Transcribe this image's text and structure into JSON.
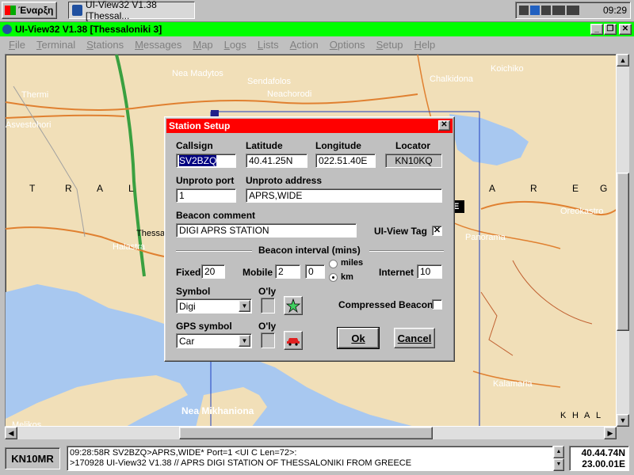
{
  "taskbar": {
    "start_label": "Έναρξη",
    "task_label": "UI-View32 V1.38 [Thessal...",
    "clock": "09:29"
  },
  "window": {
    "title": "UI-View32 V1.38 [Thessaloniki 3]"
  },
  "menu": [
    "File",
    "Terminal",
    "Stations",
    "Messages",
    "Map",
    "Logs",
    "Lists",
    "Action",
    "Options",
    "Setup",
    "Help"
  ],
  "map": {
    "labels": [
      "Nea Madytos",
      "Sendafolos",
      "Neachorodi",
      "Chalkidona",
      "Koichiko",
      "Thermi",
      "Asvestohori",
      "T",
      "R",
      "A",
      "L",
      "Thessaloniki",
      "Halastra",
      "A",
      "R",
      "E",
      "G",
      "Oreokastro",
      "Panorama",
      "Kalamaria",
      "Nea Mikhaniona",
      "Melikos",
      "K",
      "H",
      "A",
      "L",
      "E"
    ]
  },
  "status": {
    "locator": "KN10MR",
    "console_lines": [
      "09:28:58R SV2BZQ>APRS,WIDE* Port=1 <UI C Len=72>:",
      ">170928 UI-View32 V1.38 // APRS DIGI STATION OF THESSALONIKI FROM GREECE"
    ],
    "lat": "40.44.74N",
    "lon": "23.00.01E"
  },
  "dialog": {
    "title": "Station Setup",
    "callsign_label": "Callsign",
    "callsign": "SV2BZQ",
    "latitude_label": "Latitude",
    "latitude": "40.41.25N",
    "longitude_label": "Longitude",
    "longitude": "022.51.40E",
    "locator_label": "Locator",
    "locator": "KN10KQ",
    "unproto_port_label": "Unproto port",
    "unproto_port": "1",
    "unproto_address_label": "Unproto address",
    "unproto_address": "APRS,WIDE",
    "beacon_comment_label": "Beacon comment",
    "beacon_comment": "DIGI APRS STATION",
    "uiview_tag_label": "UI-View Tag",
    "uiview_tag_checked": "✕",
    "beacon_interval_label": "Beacon interval (mins)",
    "fixed_label": "Fixed",
    "fixed": "20",
    "mobile_label": "Mobile",
    "mobile": "2",
    "mobile2": "0",
    "miles_label": "miles",
    "km_label": "km",
    "internet_label": "Internet",
    "internet": "10",
    "symbol_label": "Symbol",
    "symbol_value": "Digi",
    "overlay_label": "O'ly",
    "compressed_label": "Compressed Beacon",
    "gps_symbol_label": "GPS symbol",
    "gps_symbol_value": "Car",
    "overlay2_label": "O'ly",
    "ok_label": "Ok",
    "cancel_label": "Cancel"
  },
  "colors": {
    "title_green": "#00ff00",
    "dialog_red": "#ff0000",
    "map_land": "#f1dfb8",
    "map_water": "#a8c8f0",
    "road": "#e08030",
    "motorway": "#3aa040"
  }
}
